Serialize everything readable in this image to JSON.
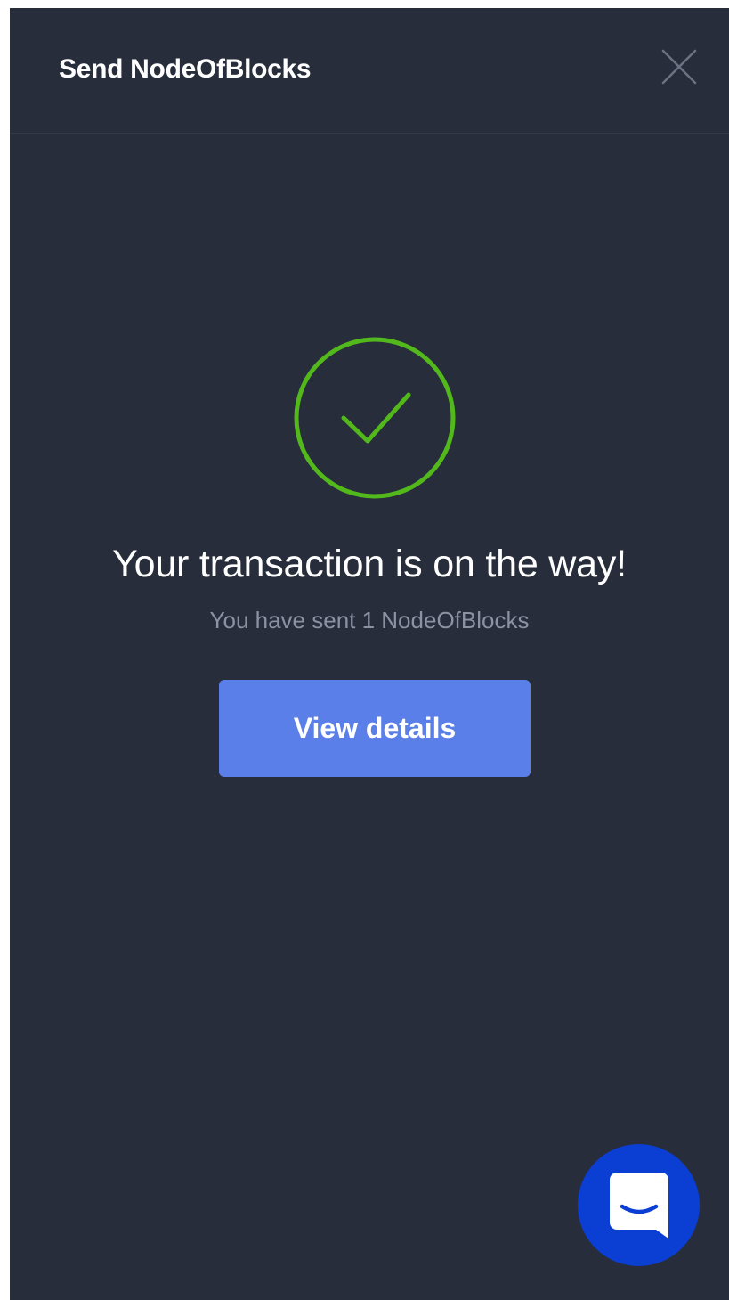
{
  "header": {
    "title": "Send NodeOfBlocks",
    "close_icon": "close-icon"
  },
  "status": {
    "icon": "check-circle-icon",
    "color": "#52b81b",
    "headline": "Your transaction is on the way!",
    "subline": "You have sent 1 NodeOfBlocks"
  },
  "actions": {
    "view_details_label": "View details",
    "button_color": "#5a7fe8"
  },
  "chat": {
    "icon": "chat-icon",
    "color": "#0b3fd4"
  },
  "theme": {
    "background": "#272d3b"
  }
}
